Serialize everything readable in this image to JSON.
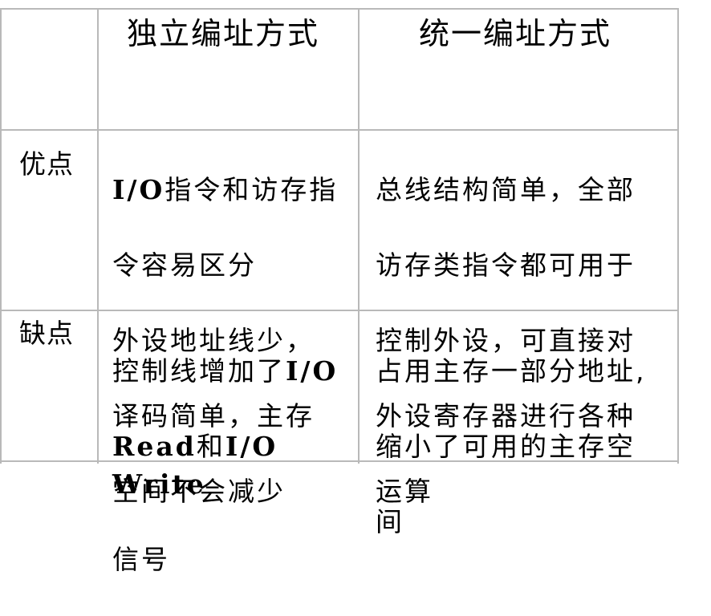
{
  "table": {
    "header": {
      "corner": "",
      "col1": "独立编址方式",
      "col2": "统一编址方式"
    },
    "rows": [
      {
        "label": "优点",
        "col1_lines": [
          "I/O指令和访存指",
          "令容易区分",
          "外设地址线少，",
          "译码简单，主存",
          "空间不会减少"
        ],
        "col2_lines": [
          "总线结构简单，全部",
          "访存类指令都可用于",
          "控制外设，可直接对",
          "外设寄存器进行各种",
          "运算"
        ]
      },
      {
        "label": "缺点",
        "col1_lines": [
          "控制线增加了I/O",
          "Read和I/O Write",
          "信号"
        ],
        "col2_lines": [
          "占用主存一部分地址,",
          "缩小了可用的主存空",
          "间"
        ]
      }
    ]
  }
}
